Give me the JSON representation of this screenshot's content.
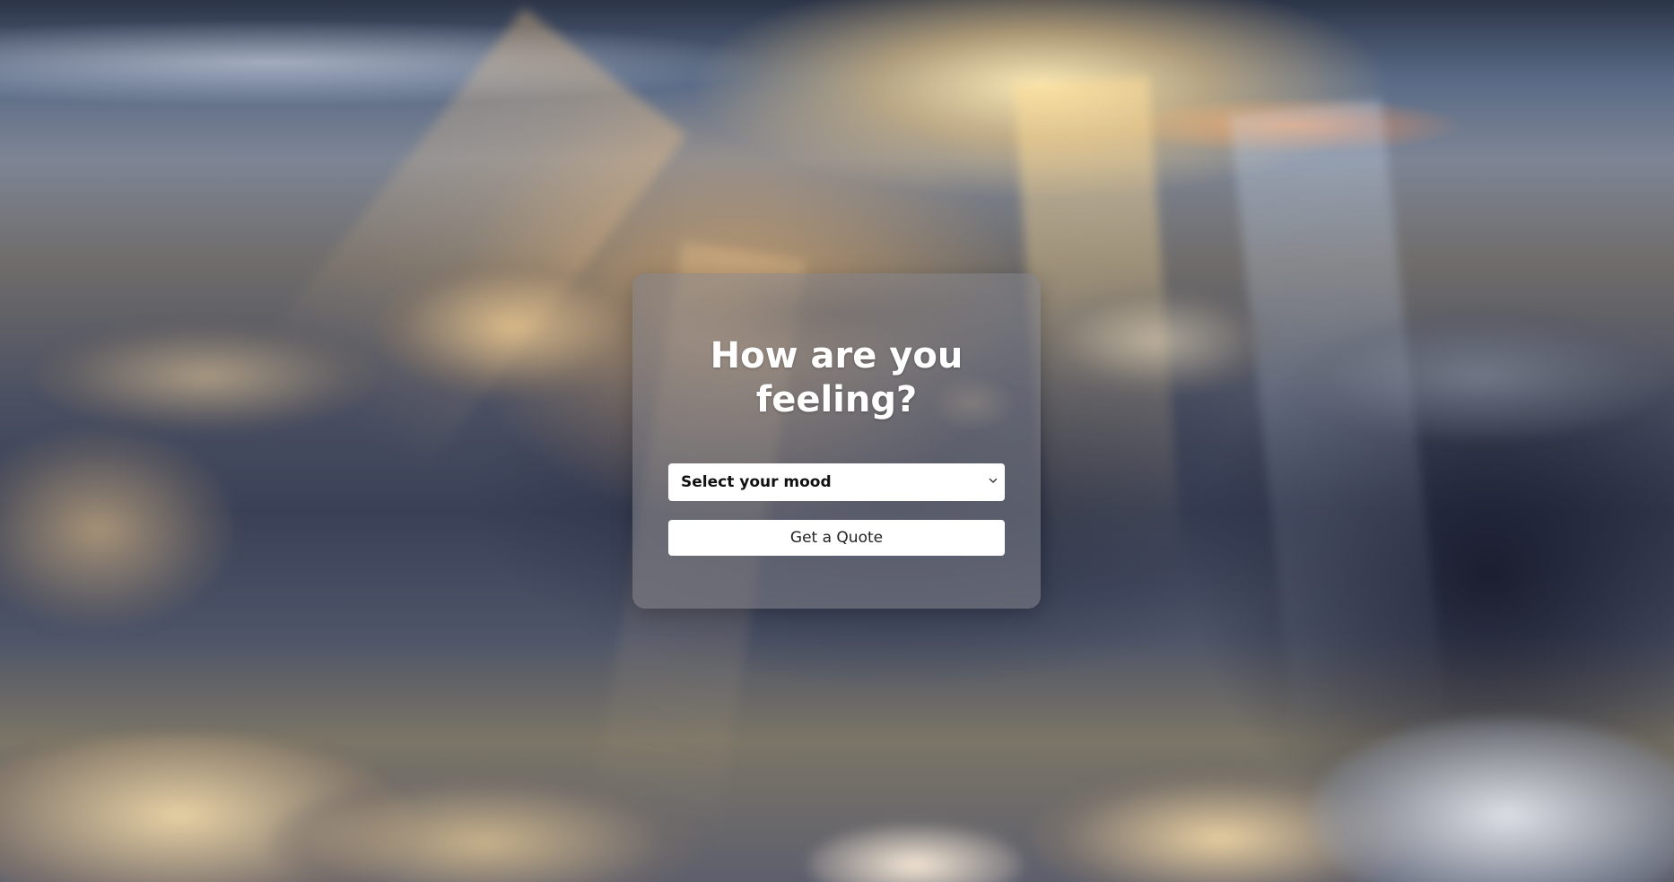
{
  "hero": {
    "title": "How are you feeling?"
  },
  "form": {
    "mood_select": {
      "selected_label": "Select your mood",
      "icon": "chevron-down-icon"
    },
    "quote_button_label": "Get a Quote"
  },
  "theme": {
    "card_background": "#828288",
    "field_background": "#ffffff",
    "title_color": "#ffffff",
    "text_color": "#111111"
  }
}
